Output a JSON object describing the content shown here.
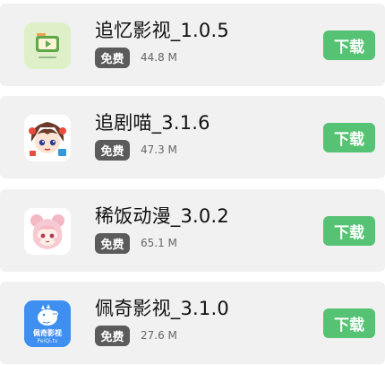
{
  "apps": [
    {
      "name": "追忆影视_1.0.5",
      "badge": "免费",
      "size": "44.8 M",
      "download_label": "下载",
      "icon": "video-player-icon"
    },
    {
      "name": "追剧喵_3.1.6",
      "badge": "免费",
      "size": "47.3 M",
      "download_label": "下载",
      "icon": "anime-girl-avatar-icon"
    },
    {
      "name": "稀饭动漫_3.0.2",
      "badge": "免费",
      "size": "65.1 M",
      "download_label": "下载",
      "icon": "pink-hair-girl-icon"
    },
    {
      "name": "佩奇影视_3.1.0",
      "badge": "免费",
      "size": "27.6 M",
      "download_label": "下载",
      "icon": "peppa-pig-icon",
      "icon_text_top": "佩奇影视",
      "icon_text_bottom": "PeiQi.tv"
    }
  ],
  "colors": {
    "card_bg": "#f1f1f1",
    "badge_bg": "#5b5b5b",
    "download_bg": "#56c274"
  }
}
